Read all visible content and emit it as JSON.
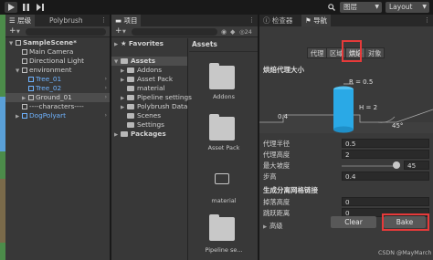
{
  "toolbar": {
    "layers_label": "图层",
    "layout_label": "Layout"
  },
  "hierarchy": {
    "tab_label": "层级",
    "tab2_label": "Polybrush",
    "add_label": "+",
    "search_placeholder": "",
    "items": [
      {
        "label": "SampleScene*"
      },
      {
        "label": "Main Camera"
      },
      {
        "label": "Directional Light"
      },
      {
        "label": "environment"
      },
      {
        "label": "Tree_01"
      },
      {
        "label": "Tree_02"
      },
      {
        "label": "Ground_01"
      },
      {
        "label": "----characters----"
      },
      {
        "label": "DogPolyart"
      }
    ]
  },
  "project": {
    "tab_label": "项目",
    "add_label": "+",
    "count_label": "24",
    "favorites_label": "Favorites",
    "assets_header": "Assets",
    "tree": [
      {
        "label": "Assets"
      },
      {
        "label": "Addons"
      },
      {
        "label": "Asset Pack"
      },
      {
        "label": "material"
      },
      {
        "label": "Pipeline settings"
      },
      {
        "label": "Polybrush Data"
      },
      {
        "label": "Scenes"
      },
      {
        "label": "Settings"
      },
      {
        "label": "Packages"
      }
    ],
    "grid": [
      {
        "label": "Addons"
      },
      {
        "label": "Asset Pack"
      },
      {
        "label": "material"
      },
      {
        "label": "Pipeline se..."
      }
    ]
  },
  "inspector": {
    "tab_inspector": "检查器",
    "tab_nav": "导航",
    "subtabs": [
      {
        "label": "代理"
      },
      {
        "label": "区域"
      },
      {
        "label": "烘焙"
      },
      {
        "label": "对象"
      }
    ],
    "section_title": "烘焙代理大小",
    "diagram": {
      "r_label": "R = 0.5",
      "h_label": "H = 2",
      "step_label": "0.4",
      "angle_label": "45°"
    },
    "props": [
      {
        "label": "代理半径",
        "value": "0.5"
      },
      {
        "label": "代理高度",
        "value": "2"
      },
      {
        "label": "最大坡度",
        "value": "45",
        "slider": 1.0
      },
      {
        "label": "步高",
        "value": "0.4"
      }
    ],
    "offmesh_title": "生成分离网格链接",
    "offmesh_props": [
      {
        "label": "掉落高度",
        "value": "0"
      },
      {
        "label": "跳跃距离",
        "value": "0"
      }
    ],
    "advanced_label": "高级",
    "clear_label": "Clear",
    "bake_label": "Bake",
    "watermark": "CSDN @MayMarch"
  },
  "colors": {
    "accent_blue": "#6fb3ff",
    "highlight_red": "#e63a3a",
    "cylinder": "#2aa9e6"
  }
}
